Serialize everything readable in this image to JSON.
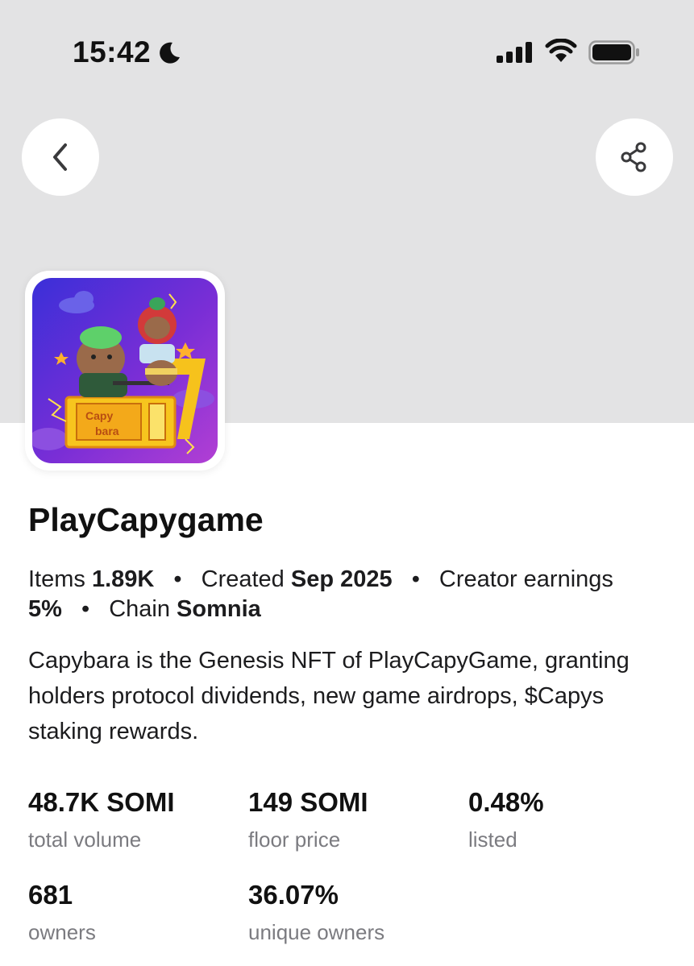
{
  "status_bar": {
    "time": "15:42",
    "moon_icon": "moon-icon",
    "signal_icon": "cellular-signal-icon",
    "wifi_icon": "wifi-icon",
    "battery_icon": "battery-icon"
  },
  "header": {
    "back_icon": "chevron-left-icon",
    "share_icon": "share-icon",
    "banner_color": "#e3e3e4"
  },
  "collection": {
    "name": "PlayCapygame",
    "logo_text": "Capy bara",
    "items_label": "Items",
    "items_value": "1.89K",
    "created_label": "Created",
    "created_value": "Sep 2025",
    "earnings_label": "Creator earnings",
    "earnings_value": "5%",
    "chain_label": "Chain",
    "chain_value": "Somnia",
    "separator": "•",
    "description": "Capybara is the Genesis NFT of PlayCapyGame, granting holders protocol dividends, new game airdrops, $Capys staking rewards."
  },
  "stats": [
    {
      "value": "48.7K SOMI",
      "label": "total volume"
    },
    {
      "value": "149 SOMI",
      "label": "floor price"
    },
    {
      "value": "0.48%",
      "label": "listed"
    },
    {
      "value": "681",
      "label": "owners"
    },
    {
      "value": "36.07%",
      "label": "unique owners"
    }
  ]
}
